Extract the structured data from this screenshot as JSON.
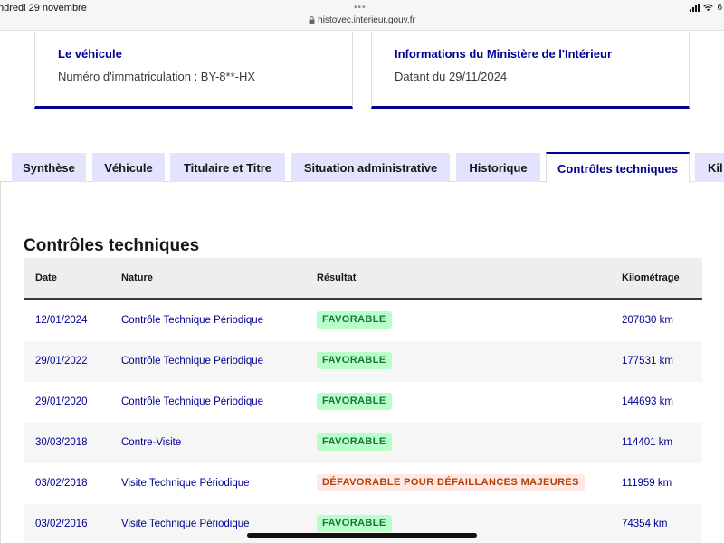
{
  "status_bar": {
    "date": "ndredi 29 novembre",
    "url": "histovec.interieur.gouv.fr",
    "battery": "6"
  },
  "cards": [
    {
      "title": "Le véhicule",
      "text": "Numéro d'immatriculation : BY-8**-HX"
    },
    {
      "title": "Informations du Ministère de l'Intérieur",
      "text": "Datant du 29/11/2024"
    }
  ],
  "tabs": [
    {
      "label": "Synthèse",
      "active": false
    },
    {
      "label": "Véhicule",
      "active": false
    },
    {
      "label": "Titulaire et Titre",
      "active": false
    },
    {
      "label": "Situation administrative",
      "active": false
    },
    {
      "label": "Historique",
      "active": false
    },
    {
      "label": "Contrôles techniques",
      "active": true
    },
    {
      "label": "Kil",
      "active": false
    }
  ],
  "section": {
    "title": "Contrôles techniques",
    "columns": [
      "Date",
      "Nature",
      "Résultat",
      "Kilométrage"
    ],
    "rows": [
      {
        "date": "12/01/2024",
        "nature": "Contrôle Technique Périodique",
        "result": "FAVORABLE",
        "status": "ok",
        "km": "207830 km"
      },
      {
        "date": "29/01/2022",
        "nature": "Contrôle Technique Périodique",
        "result": "FAVORABLE",
        "status": "ok",
        "km": "177531 km"
      },
      {
        "date": "29/01/2020",
        "nature": "Contrôle Technique Périodique",
        "result": "FAVORABLE",
        "status": "ok",
        "km": "144693 km"
      },
      {
        "date": "30/03/2018",
        "nature": "Contre-Visite",
        "result": "FAVORABLE",
        "status": "ok",
        "km": "114401 km"
      },
      {
        "date": "03/02/2018",
        "nature": "Visite Technique Périodique",
        "result": "DÉFAVORABLE POUR DÉFAILLANCES MAJEURES",
        "status": "ko",
        "km": "111959 km"
      },
      {
        "date": "03/02/2016",
        "nature": "Visite Technique Périodique",
        "result": "FAVORABLE",
        "status": "ok",
        "km": "74354 km"
      }
    ]
  },
  "colors": {
    "primary": "#000091",
    "tab_bg": "#e3e3fd",
    "success_bg": "#b8fec9",
    "success_text": "#18753c",
    "error_bg": "#ffe9e6",
    "error_text": "#b34000"
  }
}
